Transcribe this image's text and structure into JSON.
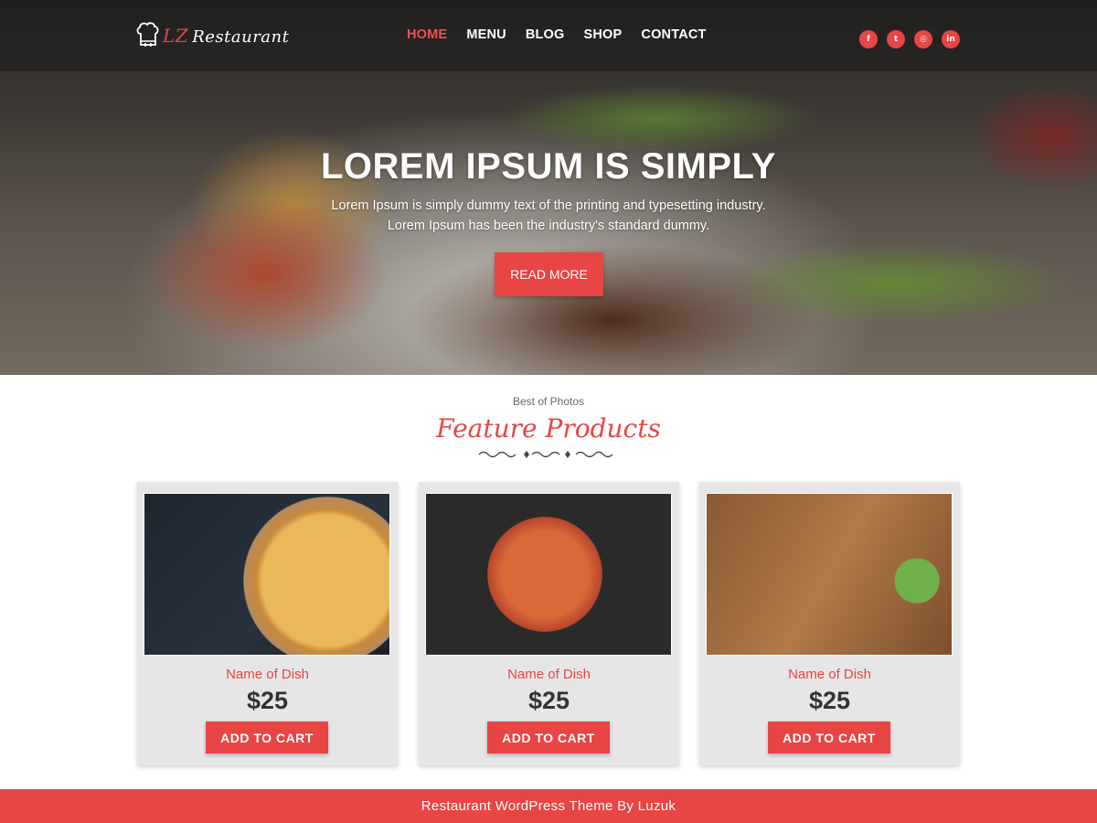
{
  "brand": {
    "logo_mark": "LZ",
    "logo_name": "Restaurant"
  },
  "nav": {
    "items": [
      {
        "label": "HOME",
        "active": true
      },
      {
        "label": "MENU",
        "active": false
      },
      {
        "label": "BLOG",
        "active": false
      },
      {
        "label": "SHOP",
        "active": false
      },
      {
        "label": "CONTACT",
        "active": false
      }
    ]
  },
  "social": [
    {
      "icon": "facebook-icon",
      "glyph": "f"
    },
    {
      "icon": "twitter-icon",
      "glyph": "t"
    },
    {
      "icon": "instagram-icon",
      "glyph": "◎"
    },
    {
      "icon": "linkedin-icon",
      "glyph": "in"
    }
  ],
  "hero": {
    "title": "LOREM IPSUM IS SIMPLY",
    "subtitle_line1": "Lorem Ipsum is simply dummy text of the printing and typesetting industry.",
    "subtitle_line2": "Lorem Ipsum has been the industry's standard dummy.",
    "button_label": "READ MORE"
  },
  "features": {
    "kicker": "Best of Photos",
    "title": "Feature Products",
    "products": [
      {
        "name": "Name of Dish",
        "price": "$25",
        "button_label": "ADD TO CART"
      },
      {
        "name": "Name of Dish",
        "price": "$25",
        "button_label": "ADD TO CART"
      },
      {
        "name": "Name of Dish",
        "price": "$25",
        "button_label": "ADD TO CART"
      }
    ]
  },
  "footer": {
    "text": "Restaurant WordPress Theme By Luzuk"
  },
  "colors": {
    "accent": "#e84545",
    "card_bg": "#e6e6e6",
    "price_text": "#333333"
  }
}
